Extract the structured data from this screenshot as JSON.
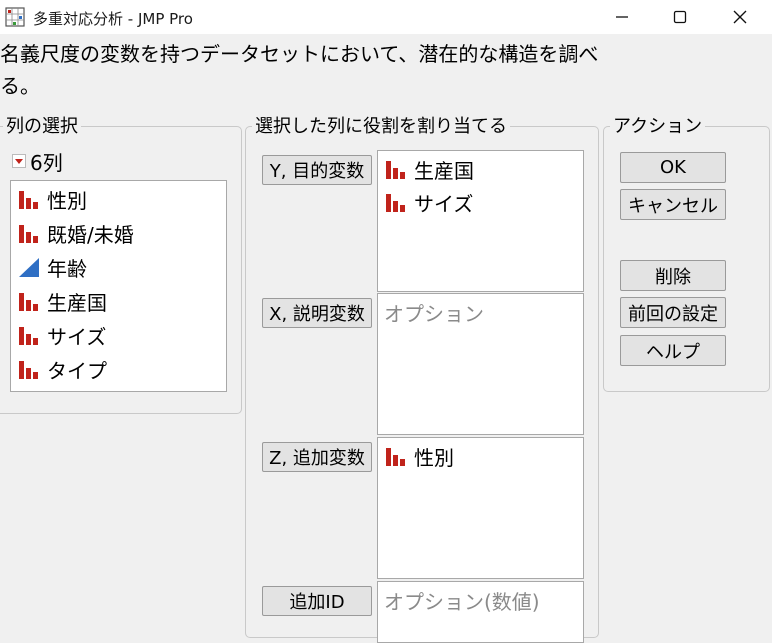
{
  "window": {
    "title": "多重対応分析 - JMP Pro",
    "controls": {
      "minimize": "minimize-icon",
      "maximize": "maximize-icon",
      "close": "close-icon"
    }
  },
  "description": {
    "line1": "名義尺度の変数を持つデータセットにおいて、潜在的な構造を調べ",
    "line2": "る。"
  },
  "column_select": {
    "legend": "列の選択",
    "count_label": "6列",
    "columns": [
      {
        "label": "性別",
        "icon": "nominal-bar-icon"
      },
      {
        "label": "既婚/未婚",
        "icon": "nominal-bar-icon"
      },
      {
        "label": "年齢",
        "icon": "continuous-triangle-icon"
      },
      {
        "label": "生産国",
        "icon": "nominal-bar-icon"
      },
      {
        "label": "サイズ",
        "icon": "nominal-bar-icon"
      },
      {
        "label": "タイプ",
        "icon": "nominal-bar-icon"
      }
    ]
  },
  "roles": {
    "legend": "選択した列に役割を割り当てる",
    "y": {
      "button": "Y, 目的変数",
      "items": [
        "生産国",
        "サイズ"
      ]
    },
    "x": {
      "button": "X, 説明変数",
      "placeholder": "オプション"
    },
    "z": {
      "button": "Z, 追加変数",
      "items": [
        "性別"
      ]
    },
    "id": {
      "button": "追加ID",
      "placeholder": "オプション(数値)"
    }
  },
  "actions": {
    "legend": "アクション",
    "ok": "OK",
    "cancel": "キャンセル",
    "remove": "削除",
    "recall": "前回の設定",
    "help": "ヘルプ"
  },
  "colors": {
    "nominal_icon": "#c0231b",
    "continuous_icon": "#2f6fc4",
    "dropdown_arrow": "#c0231b"
  }
}
